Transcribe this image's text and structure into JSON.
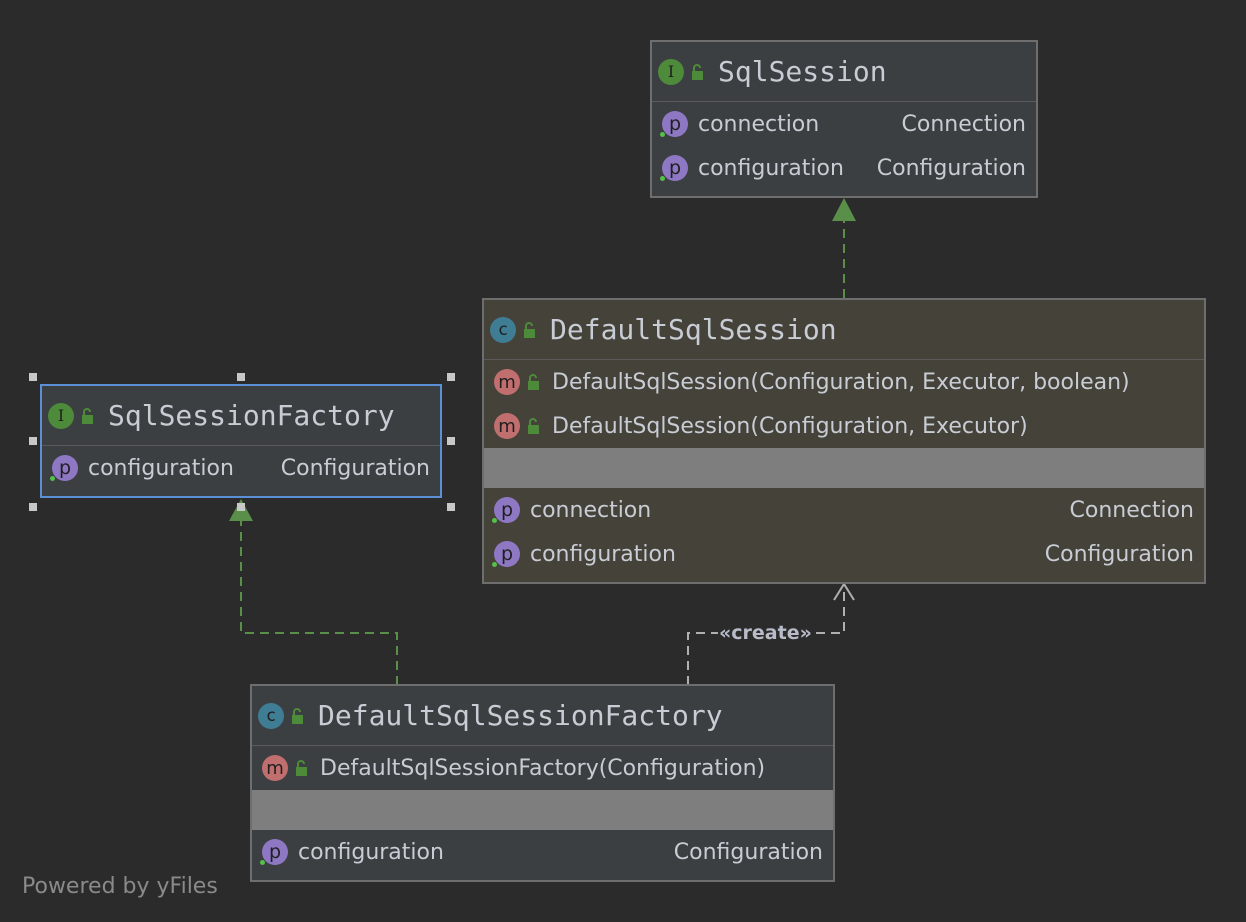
{
  "nodes": {
    "sql_session": {
      "kind_letter": "I",
      "name": "SqlSession",
      "fields": [
        {
          "badge": "p",
          "name": "connection",
          "type": "Connection"
        },
        {
          "badge": "p",
          "name": "configuration",
          "type": "Configuration"
        }
      ]
    },
    "default_sql_session": {
      "kind_letter": "c",
      "name": "DefaultSqlSession",
      "methods": [
        {
          "badge": "m",
          "signature": "DefaultSqlSession(Configuration, Executor, boolean)"
        },
        {
          "badge": "m",
          "signature": "DefaultSqlSession(Configuration, Executor)"
        }
      ],
      "fields": [
        {
          "badge": "p",
          "name": "connection",
          "type": "Connection"
        },
        {
          "badge": "p",
          "name": "configuration",
          "type": "Configuration"
        }
      ]
    },
    "sql_session_factory": {
      "kind_letter": "I",
      "name": "SqlSessionFactory",
      "fields": [
        {
          "badge": "p",
          "name": "configuration",
          "type": "Configuration"
        }
      ]
    },
    "default_sql_session_factory": {
      "kind_letter": "c",
      "name": "DefaultSqlSessionFactory",
      "methods": [
        {
          "badge": "m",
          "signature": "DefaultSqlSessionFactory(Configuration)"
        }
      ],
      "fields": [
        {
          "badge": "p",
          "name": "configuration",
          "type": "Configuration"
        }
      ]
    }
  },
  "edges": {
    "create_label": "«create»"
  },
  "footer": "Powered by yFiles",
  "colors": {
    "background": "#2b2b2b",
    "interface_badge": "#4d8a3a",
    "class_badge": "#3f7d94",
    "method_badge": "#c06e6e",
    "property_badge": "#8e78c4",
    "realization_edge": "#5a8f4a",
    "dependency_edge": "#b0b0b0",
    "selection": "#5b8fd6"
  }
}
